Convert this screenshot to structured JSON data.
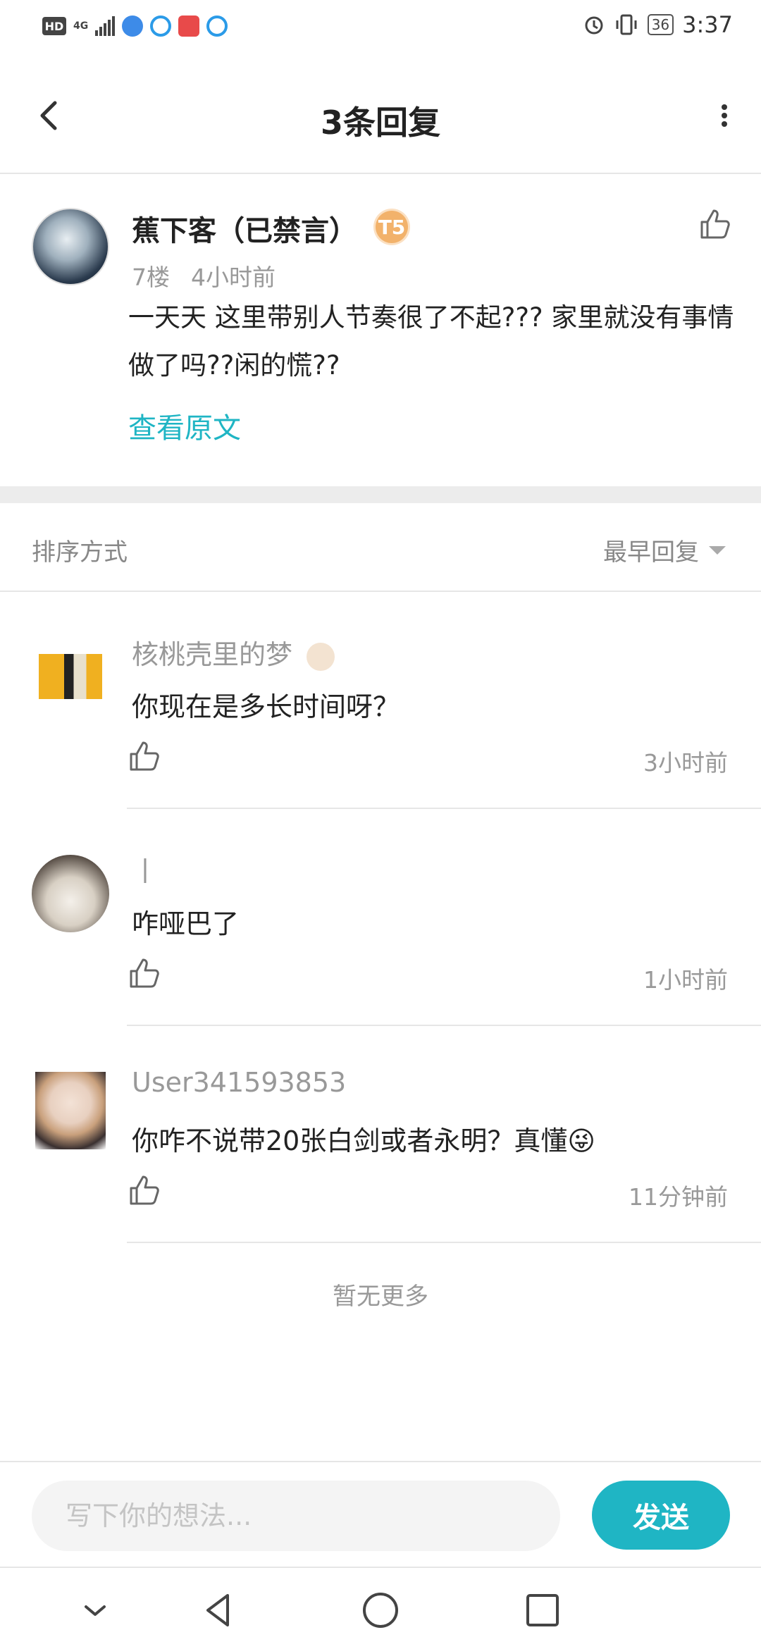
{
  "status_bar": {
    "hd": "HD",
    "network": "4G",
    "battery": "36",
    "time": "3:37"
  },
  "header": {
    "title": "3条回复",
    "back_icon": "chevron-left-icon",
    "more_icon": "more-vertical-icon"
  },
  "post": {
    "username": "蕉下客（已禁言）",
    "badge": "T5",
    "floor": "7楼",
    "time": "4小时前",
    "text": "一天天 这里带别人节奏很了不起??? 家里就没有事情做了吗??闲的慌??",
    "view_original": "查看原文"
  },
  "sort": {
    "label": "排序方式",
    "value": "最早回复"
  },
  "replies": [
    {
      "username": "核桃壳里的梦",
      "text": "你现在是多长时间呀？",
      "time": "3小时前"
    },
    {
      "username": "丨",
      "text": "咋哑巴了",
      "time": "1小时前"
    },
    {
      "username": "User341593853",
      "text": "你咋不说带20张白剑或者永明？真懂😜",
      "time": "11分钟前"
    }
  ],
  "no_more": "暂无更多",
  "input": {
    "placeholder": "写下你的想法...",
    "send_label": "发送"
  },
  "colors": {
    "accent": "#1fb5c4",
    "badge": "#f2b26b"
  }
}
